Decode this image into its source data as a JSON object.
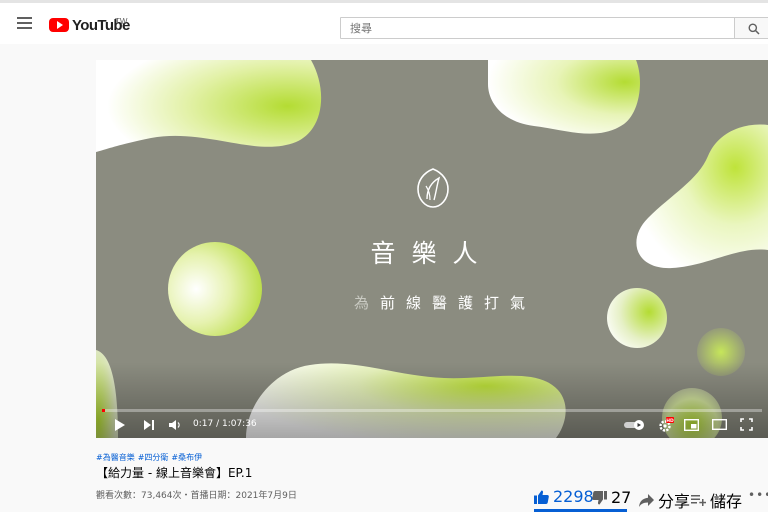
{
  "header": {
    "logo_text": "YouTube",
    "region": "TW",
    "search_placeholder": "搜尋"
  },
  "video": {
    "main_title": "音樂人",
    "subtitle_first": "為",
    "subtitle_rest": "前線醫護打氣",
    "time_display": "0:17 / 1:07:36",
    "progress_fraction": 0.0042
  },
  "info": {
    "hashtags": [
      "#為醫音樂",
      "#四分衛",
      "#桑布伊"
    ],
    "title": "【給力量 - 線上音樂會】EP.1",
    "views_line": "觀看次數：73,464次・首播日期：2021年7月9日"
  },
  "actions": {
    "likes": "2298",
    "dislikes": "27",
    "share_label": "分享",
    "save_label": "儲存",
    "more_label": "•••"
  },
  "colors": {
    "accent_blue": "#065fd4",
    "youtube_red": "#ff0000",
    "player_bg": "#8b8c80",
    "lime": "#b4dc33"
  },
  "icons": {
    "menu": "hamburger-menu-icon",
    "search": "search-icon",
    "play": "play-icon",
    "next": "skip-next-icon",
    "volume": "volume-icon",
    "autoplay": "autoplay-toggle-icon",
    "settings": "gear-icon",
    "miniplayer": "miniplayer-icon",
    "theater": "theater-mode-icon",
    "fullscreen": "fullscreen-icon",
    "like": "thumbs-up-icon",
    "dislike": "thumbs-down-icon",
    "share": "share-arrow-icon",
    "save": "playlist-add-icon"
  }
}
